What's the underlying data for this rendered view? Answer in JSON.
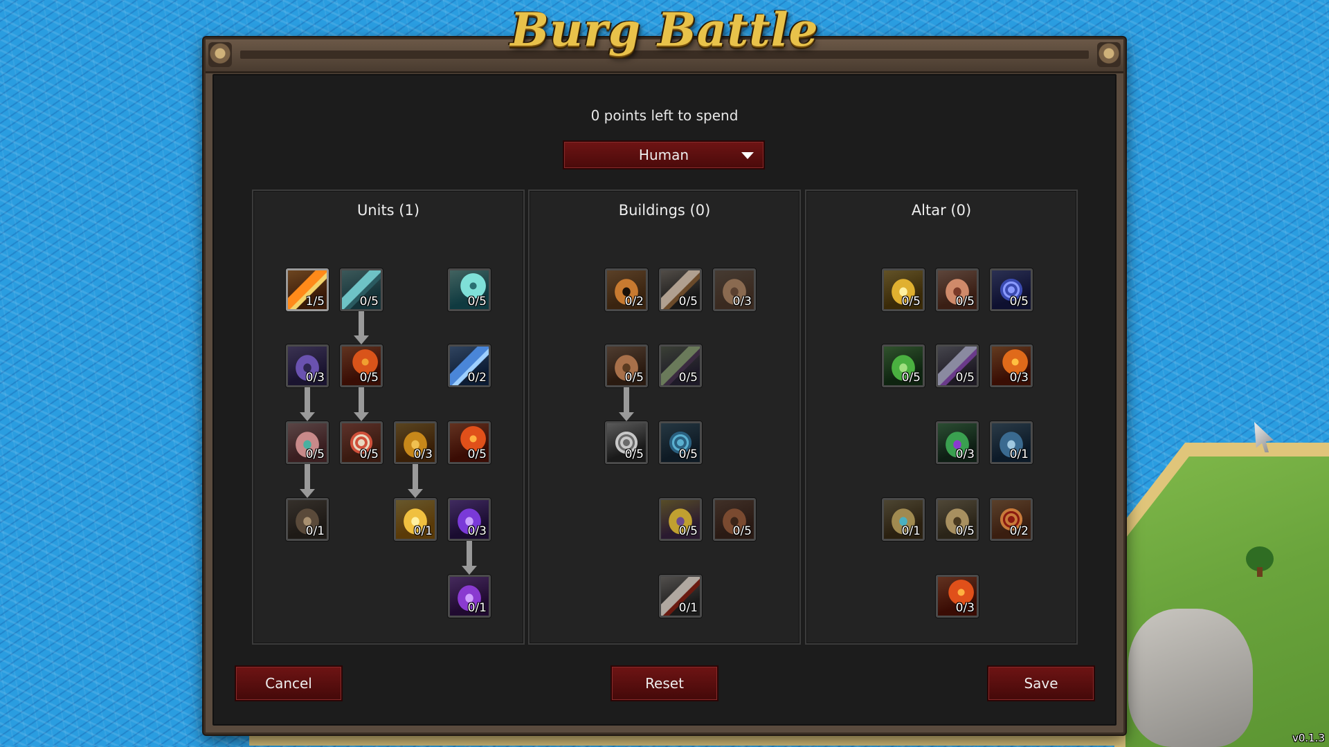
{
  "game_title": "Burg Battle",
  "points_text": "0 points left to spend",
  "race_select": {
    "value": "Human"
  },
  "panels": {
    "units": {
      "title": "Units (1)",
      "nodes": [
        {
          "name": "unit-fire-arrow",
          "count": "1/5",
          "icon": "flaming-arrowhead-icon",
          "colors": [
            "#3a1a08",
            "#ff8a1a",
            "#f3d36b"
          ]
        },
        {
          "name": "unit-arrow-volley",
          "count": "0/5",
          "icon": "arrow-volley-icon",
          "colors": [
            "#143238",
            "#6ec3c6",
            "#2a5a60"
          ]
        },
        {
          "name": "unit-frost-burst",
          "count": "0/5",
          "icon": "frost-burst-icon",
          "colors": [
            "#0f3a40",
            "#7fe0d8",
            "#2a6f72"
          ]
        },
        {
          "name": "unit-hooded-knight",
          "count": "0/3",
          "icon": "helmet-icon",
          "colors": [
            "#1a1430",
            "#6a52b0",
            "#2e2550"
          ]
        },
        {
          "name": "unit-fire-spikes",
          "count": "0/5",
          "icon": "fire-spikes-icon",
          "colors": [
            "#3a0e05",
            "#d9541a",
            "#f0a030"
          ]
        },
        {
          "name": "unit-wind-slash",
          "count": "0/2",
          "icon": "wind-slash-icon",
          "colors": [
            "#0c1c34",
            "#4a86d8",
            "#9fd0ff"
          ]
        },
        {
          "name": "unit-war-horn",
          "count": "0/5",
          "icon": "horn-icon",
          "colors": [
            "#3a1e20",
            "#c98a8a",
            "#4ab0a0"
          ]
        },
        {
          "name": "unit-target",
          "count": "0/5",
          "icon": "target-icon",
          "colors": [
            "#3a1a10",
            "#d0503a",
            "#e8d8c0"
          ]
        },
        {
          "name": "unit-golden-shield",
          "count": "0/3",
          "icon": "shield-icon",
          "colors": [
            "#3a2008",
            "#c8881a",
            "#f0c050"
          ]
        },
        {
          "name": "unit-fireball",
          "count": "0/5",
          "icon": "fireball-icon",
          "colors": [
            "#3a0c04",
            "#e0501a",
            "#ffb040"
          ]
        },
        {
          "name": "unit-iron-boots",
          "count": "0/1",
          "icon": "boots-icon",
          "colors": [
            "#1e1a16",
            "#5a4a3a",
            "#a89070"
          ]
        },
        {
          "name": "unit-ascension",
          "count": "0/1",
          "icon": "ascension-icon",
          "colors": [
            "#5a3a08",
            "#f0c040",
            "#fff0a0"
          ]
        },
        {
          "name": "unit-shadow-strike",
          "count": "0/3",
          "icon": "shadow-strike-icon",
          "colors": [
            "#1a0c30",
            "#7a3ad8",
            "#c8a0ff"
          ]
        },
        {
          "name": "unit-dark-mage",
          "count": "0/1",
          "icon": "hooded-mage-icon",
          "colors": [
            "#200a30",
            "#8a3ad0",
            "#d0a0ff"
          ]
        }
      ]
    },
    "buildings": {
      "title": "Buildings (0)",
      "nodes": [
        {
          "name": "building-tower",
          "count": "0/2",
          "icon": "tower-icon",
          "colors": [
            "#3a2410",
            "#c87a30",
            "#1a1008"
          ]
        },
        {
          "name": "building-sword",
          "count": "0/5",
          "icon": "sword-icon",
          "colors": [
            "#181818",
            "#b0a090",
            "#6a4a2a"
          ]
        },
        {
          "name": "building-wall",
          "count": "0/3",
          "icon": "brick-wall-icon",
          "colors": [
            "#3a2a20",
            "#8a6a50",
            "#5a4030"
          ]
        },
        {
          "name": "building-gold-sack",
          "count": "0/5",
          "icon": "money-sack-icon",
          "colors": [
            "#2a1a10",
            "#a8704a",
            "#5a3a20"
          ]
        },
        {
          "name": "building-arrows",
          "count": "0/5",
          "icon": "arrows-icon",
          "colors": [
            "#1e1a28",
            "#6a7a5a",
            "#3a2a40"
          ]
        },
        {
          "name": "building-silver-coins",
          "count": "0/5",
          "icon": "coins-icon",
          "colors": [
            "#1a1a1a",
            "#c8c8c8",
            "#6a6a6a"
          ]
        },
        {
          "name": "building-sapphire",
          "count": "0/5",
          "icon": "gem-icon",
          "colors": [
            "#0e1a24",
            "#2a6080",
            "#5ab0d0"
          ]
        },
        {
          "name": "building-spellbook",
          "count": "0/5",
          "icon": "spellbook-icon",
          "colors": [
            "#2a1a30",
            "#c0a030",
            "#6a4a8a"
          ]
        },
        {
          "name": "building-armor",
          "count": "0/5",
          "icon": "armor-icon",
          "colors": [
            "#2a1a14",
            "#7a4a30",
            "#3a2418"
          ]
        },
        {
          "name": "building-spear",
          "count": "0/1",
          "icon": "spear-icon",
          "colors": [
            "#1a1a1a",
            "#b0a8a0",
            "#6a1a10"
          ]
        }
      ]
    },
    "altar": {
      "title": "Altar (0)",
      "nodes": [
        {
          "name": "altar-gold-bar",
          "count": "0/5",
          "icon": "gold-bar-icon",
          "colors": [
            "#3a2a08",
            "#e0b030",
            "#fff0a0"
          ]
        },
        {
          "name": "altar-fist",
          "count": "0/5",
          "icon": "fist-icon",
          "colors": [
            "#3a1e14",
            "#d08a6a",
            "#7a3a28"
          ]
        },
        {
          "name": "altar-vortex",
          "count": "0/5",
          "icon": "vortex-icon",
          "colors": [
            "#0e1030",
            "#3a4ab0",
            "#8a9aff"
          ]
        },
        {
          "name": "altar-leaf",
          "count": "0/5",
          "icon": "leaf-icon",
          "colors": [
            "#0e2410",
            "#4ab040",
            "#a0e080"
          ]
        },
        {
          "name": "altar-arrow-burst",
          "count": "0/5",
          "icon": "arrow-burst-icon",
          "colors": [
            "#1e1a24",
            "#8a8aa0",
            "#6a3a8a"
          ]
        },
        {
          "name": "altar-fire-whip",
          "count": "0/3",
          "icon": "fire-whip-icon",
          "colors": [
            "#3a0e04",
            "#e06a1a",
            "#ffc040"
          ]
        },
        {
          "name": "altar-nature-staff",
          "count": "0/3",
          "icon": "staff-icon",
          "colors": [
            "#0e1e14",
            "#3aa050",
            "#8a3ad0"
          ]
        },
        {
          "name": "altar-wolf",
          "count": "0/1",
          "icon": "wolf-icon",
          "colors": [
            "#0c1a28",
            "#3a6a90",
            "#a0c8e0"
          ]
        },
        {
          "name": "altar-magnifier",
          "count": "0/1",
          "icon": "magnifier-icon",
          "colors": [
            "#2a2010",
            "#a08a50",
            "#4ab0c0"
          ]
        },
        {
          "name": "altar-scroll",
          "count": "0/5",
          "icon": "scroll-icon",
          "colors": [
            "#2a2418",
            "#a89060",
            "#4a3a20"
          ]
        },
        {
          "name": "altar-wax-seal",
          "count": "0/2",
          "icon": "wax-seal-icon",
          "colors": [
            "#3a1e10",
            "#c87a3a",
            "#8a1a10"
          ]
        },
        {
          "name": "altar-meteor",
          "count": "0/3",
          "icon": "meteor-icon",
          "colors": [
            "#3a0c04",
            "#e0501a",
            "#ffb040"
          ]
        }
      ]
    }
  },
  "buttons": {
    "cancel": "Cancel",
    "reset": "Reset",
    "save": "Save"
  },
  "version": "v0.1.3"
}
